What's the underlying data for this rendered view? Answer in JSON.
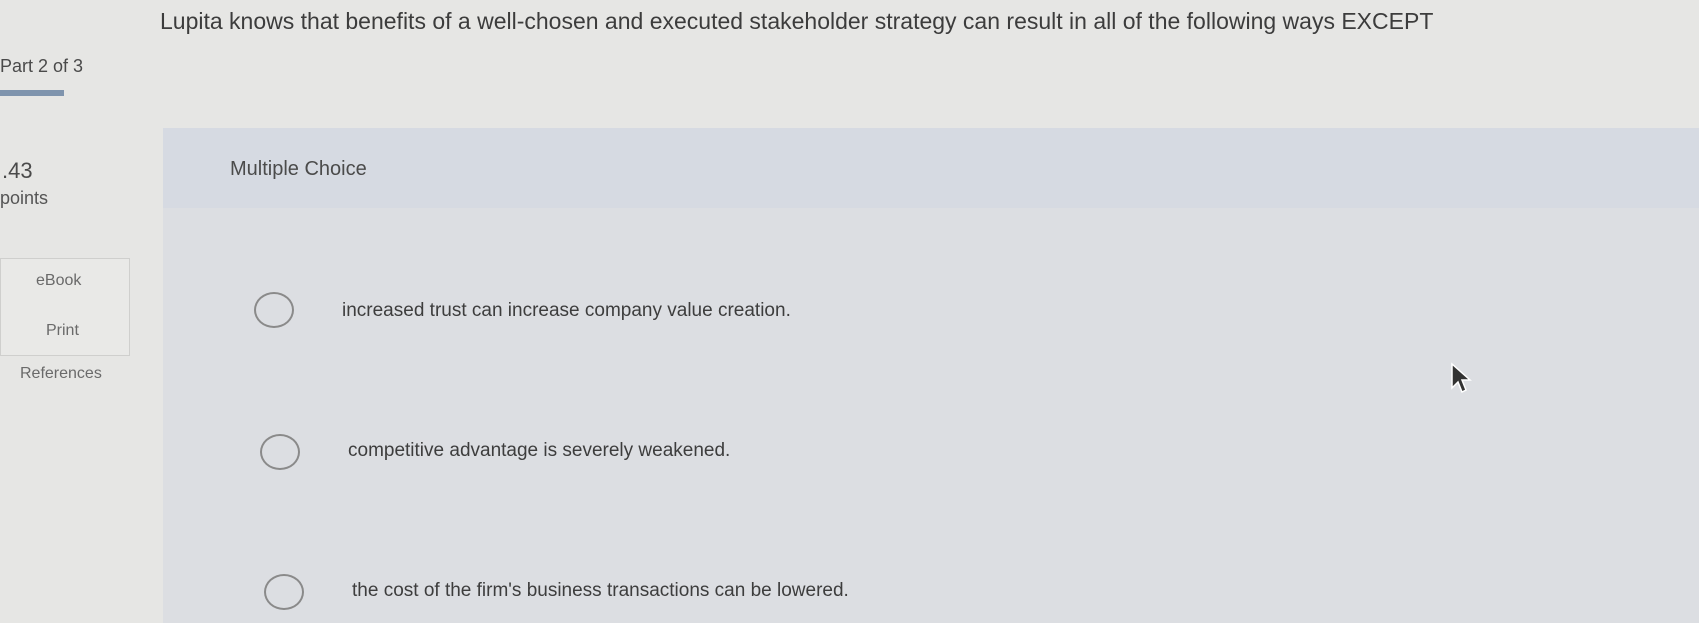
{
  "sidebar": {
    "part_label": "Part 2 of 3",
    "points_value": ".43",
    "points_label": "points",
    "resources": [
      {
        "label": "eBook"
      },
      {
        "label": "Print"
      },
      {
        "label": "References"
      }
    ]
  },
  "question": {
    "text": "Lupita knows that benefits of a well-chosen and executed stakeholder strategy can result in all of the following ways EXCEPT",
    "type_label": "Multiple Choice",
    "options": [
      {
        "text": "increased trust can increase company value creation."
      },
      {
        "text": "competitive advantage is severely weakened."
      },
      {
        "text": "the cost of the firm's business transactions can be lowered."
      }
    ]
  },
  "colors": {
    "background": "#e6e6e4",
    "panel": "#dcdee2",
    "progress_bar": "#7f94ad"
  },
  "icons": {
    "cursor": "mouse-pointer-icon"
  }
}
